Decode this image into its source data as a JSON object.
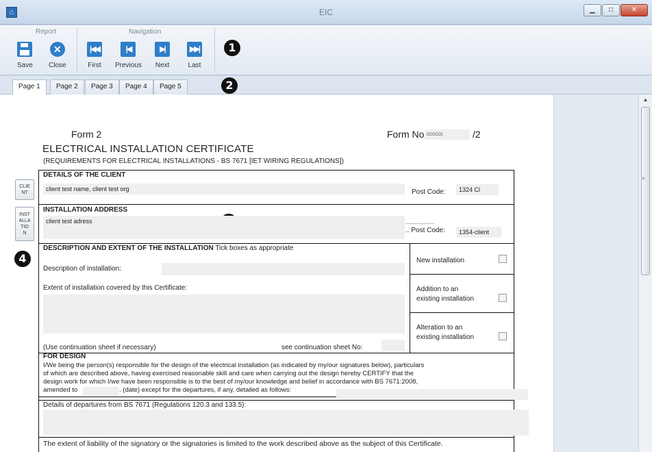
{
  "window": {
    "title": "EIC",
    "app_icon": "home-icon",
    "buttons": {
      "minimize": "minimize-icon",
      "maximize": "maximize-icon",
      "close": "close-icon"
    }
  },
  "ribbon": {
    "report_group": "Report",
    "navigation_group": "Navigation",
    "save": "Save",
    "close": "Close",
    "first": "First",
    "previous": "Previous",
    "next": "Next",
    "last": "Last"
  },
  "callouts": {
    "one": "1",
    "two": "2",
    "three": "3",
    "four": "4"
  },
  "tabs": [
    "Page 1",
    "Page 2",
    "Page 3",
    "Page 4",
    "Page 5"
  ],
  "side_buttons": {
    "client": [
      "CLIE",
      "NT"
    ],
    "installation": [
      "INST",
      "ALLA",
      "TIO",
      "N"
    ]
  },
  "form": {
    "form_label": "Form 2",
    "form_no_label": "Form No:",
    "form_no_value": "cccccc",
    "form_no_suffix": "/2",
    "title": "ELECTRICAL INSTALLATION CERTIFICATE",
    "subtitle": "(REQUIREMENTS FOR ELECTRICAL INSTALLATIONS - BS 7671 [IET WIRING REGULATIONS])",
    "client": {
      "heading": "DETAILS OF THE CLIENT",
      "value": "client test name, client test org",
      "postcode_label": "Post Code:",
      "postcode_value": "1324 Cl"
    },
    "installation": {
      "heading": "INSTALLATION ADDRESS",
      "value": "client test adress",
      "dots": "...................",
      "postcode_label": ".. Post Code:",
      "postcode_value": "1354-client"
    },
    "description": {
      "heading": "DESCRIPTION AND EXTENT OF THE INSTALLATION",
      "heading_note": "Tick boxes as appropriate",
      "desc_label": "Description of installation:",
      "extent_label": "Extent of installation covered by this Certificate:",
      "continuation_label": "(Use continuation sheet if necessary)",
      "see_sheet_label": "see continuation sheet No:",
      "options": [
        [
          "New installation"
        ],
        [
          "Addition to an",
          "existing installation"
        ],
        [
          "Alteration to an",
          "existing installation"
        ]
      ]
    },
    "design": {
      "heading": "FOR DESIGN",
      "lines": [
        "I/We being the person(s) responsible for the design of the electrical installation (as indicated by my/our signatures below), particulars",
        "of which are described above, having exercised reasonable skill and care when carrying out the design hereby CERTIFY that the",
        "design work for which I/we have been responsible is to the best of my/our knowledge and belief in accordance with BS 7671:2008,"
      ],
      "amended_label": "amended to",
      "date_note": ". (date) except for the departures, if any, detailed as follows:",
      "departures_label": "Details of departures from BS 7671 (Regulations 120.3 and 133.5):",
      "liability": "The extent of liability of the signatory or the signatories is limited to the work described above as the subject of this Certificate."
    }
  }
}
